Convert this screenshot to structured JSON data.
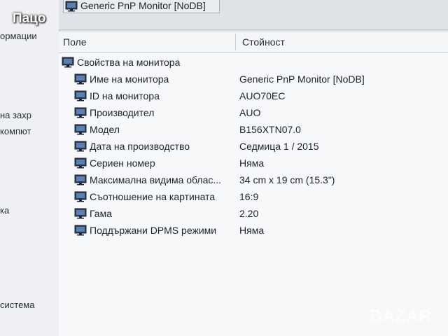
{
  "overlay_text": "Пацо",
  "watermark": "BAZAR",
  "window_title": "Generic PnP Monitor [NoDB]",
  "left_pane": {
    "lines": [
      "ормации",
      "на захр",
      "компют",
      "ка",
      "система"
    ]
  },
  "columns": {
    "field": "Поле",
    "value": "Стойност"
  },
  "group": {
    "label": "Свойства на монитора",
    "icon": "monitor-icon"
  },
  "properties": [
    {
      "label": "Име на монитора",
      "value": "Generic PnP Monitor [NoDB]"
    },
    {
      "label": "ID на монитора",
      "value": "AUO70EC"
    },
    {
      "label": "Производител",
      "value": "AUO"
    },
    {
      "label": "Модел",
      "value": "B156XTN07.0"
    },
    {
      "label": "Дата на производство",
      "value": "Седмица 1 / 2015"
    },
    {
      "label": "Сериен номер",
      "value": "Няма"
    },
    {
      "label": "Максимална видима облас...",
      "value": "34 cm x 19 cm (15.3\")"
    },
    {
      "label": "Съотношение на картината",
      "value": "16:9"
    },
    {
      "label": "Гама",
      "value": "2.20"
    },
    {
      "label": "Поддържани DPMS режими",
      "value": "Няма"
    }
  ]
}
